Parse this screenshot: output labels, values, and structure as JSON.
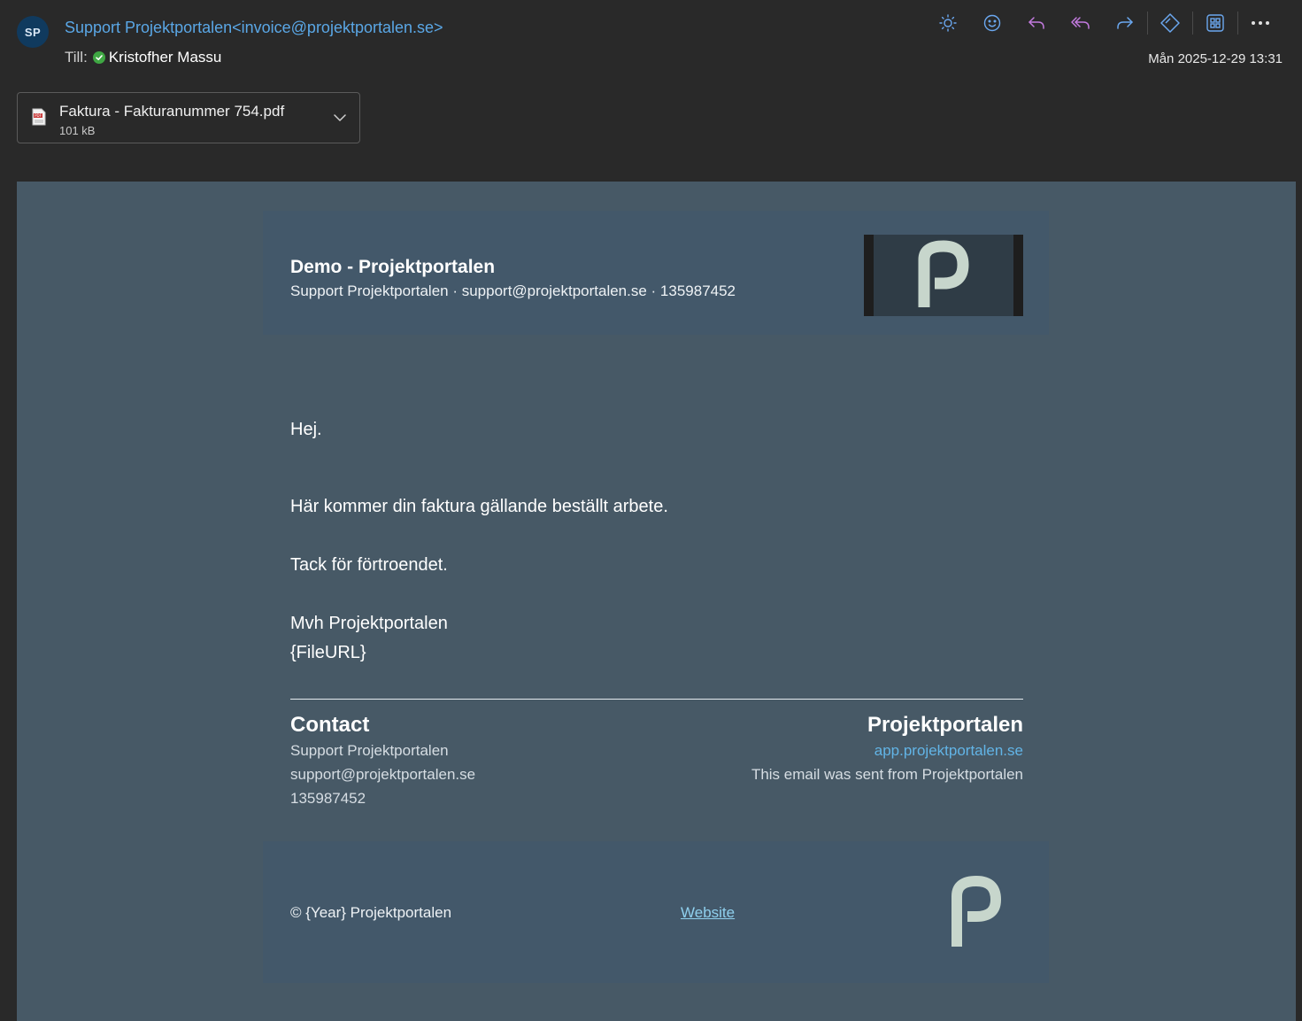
{
  "header": {
    "avatar_initials": "SP",
    "from": "Support Projektportalen<invoice@projektportalen.se>",
    "to_label": "Till:",
    "recipient": "Kristofher Massu",
    "date": "Mån 2025-12-29 13:31"
  },
  "toolbar": {
    "icons": [
      "sun-icon",
      "emoji-icon",
      "reply-icon",
      "reply-all-icon",
      "forward-icon",
      "tag-icon",
      "apps-icon",
      "more-icon"
    ]
  },
  "attachment": {
    "name": "Faktura - Fakturanummer 754.pdf",
    "size": "101 kB",
    "type_badge": "PDF"
  },
  "email": {
    "company_name": "Demo - Projektportalen",
    "company_sub": "Support Projektportalen · support@projektportalen.se · 135987452",
    "greeting": "Hej.",
    "body_line1": "Här kommer din faktura gällande beställt arbete.",
    "body_line2": "Tack för förtroendet.",
    "body_line3": "Mvh Projektportalen",
    "body_line4": "{FileURL}",
    "contact": {
      "heading": "Contact",
      "name": "Support Projektportalen",
      "email": "support@projektportalen.se",
      "phone": "135987452"
    },
    "brand": {
      "heading": "Projektportalen",
      "link": "app.projektportalen.se",
      "note": "This email was sent from Projektportalen"
    },
    "footer": {
      "copyright": "© {Year} Projektportalen",
      "website": "Website"
    }
  },
  "colors": {
    "background": "#292929",
    "mail_background": "#475966",
    "link": "#5aa7e6",
    "logo": "#c7d6cc",
    "action_purple": "#c47be0",
    "action_blue": "#6ba8f0"
  }
}
